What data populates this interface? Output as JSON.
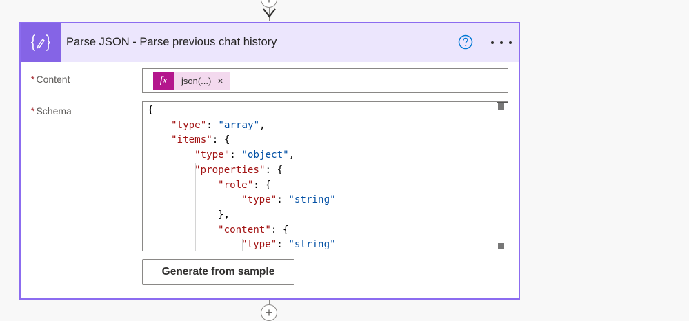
{
  "canvas": {
    "add_step_symbol": "+"
  },
  "action": {
    "title": "Parse JSON - Parse previous chat history",
    "icon": "braces-icon",
    "help_icon": "help-circle-icon",
    "more_icon": "ellipsis-icon",
    "colors": {
      "accent": "#8564e6",
      "header_bg": "#ece6fd",
      "border": "#8c6cf0",
      "token_bg": "#f3d9ee",
      "token_fx": "#b4168d",
      "help": "#0078d4"
    }
  },
  "fields": {
    "content": {
      "required_mark": "*",
      "label": "Content",
      "token": {
        "fx_label": "fx",
        "label": "json(...)",
        "remove_symbol": "×"
      }
    },
    "schema": {
      "required_mark": "*",
      "label": "Schema",
      "code_lines": [
        "{",
        "\"type\": \"array\",",
        "\"items\": {",
        "\"type\": \"object\",",
        "\"properties\": {",
        "\"role\": {",
        "\"type\": \"string\"",
        "},",
        "\"content\": {",
        "\"type\": \"string\""
      ]
    }
  },
  "buttons": {
    "generate_label": "Generate from sample"
  }
}
